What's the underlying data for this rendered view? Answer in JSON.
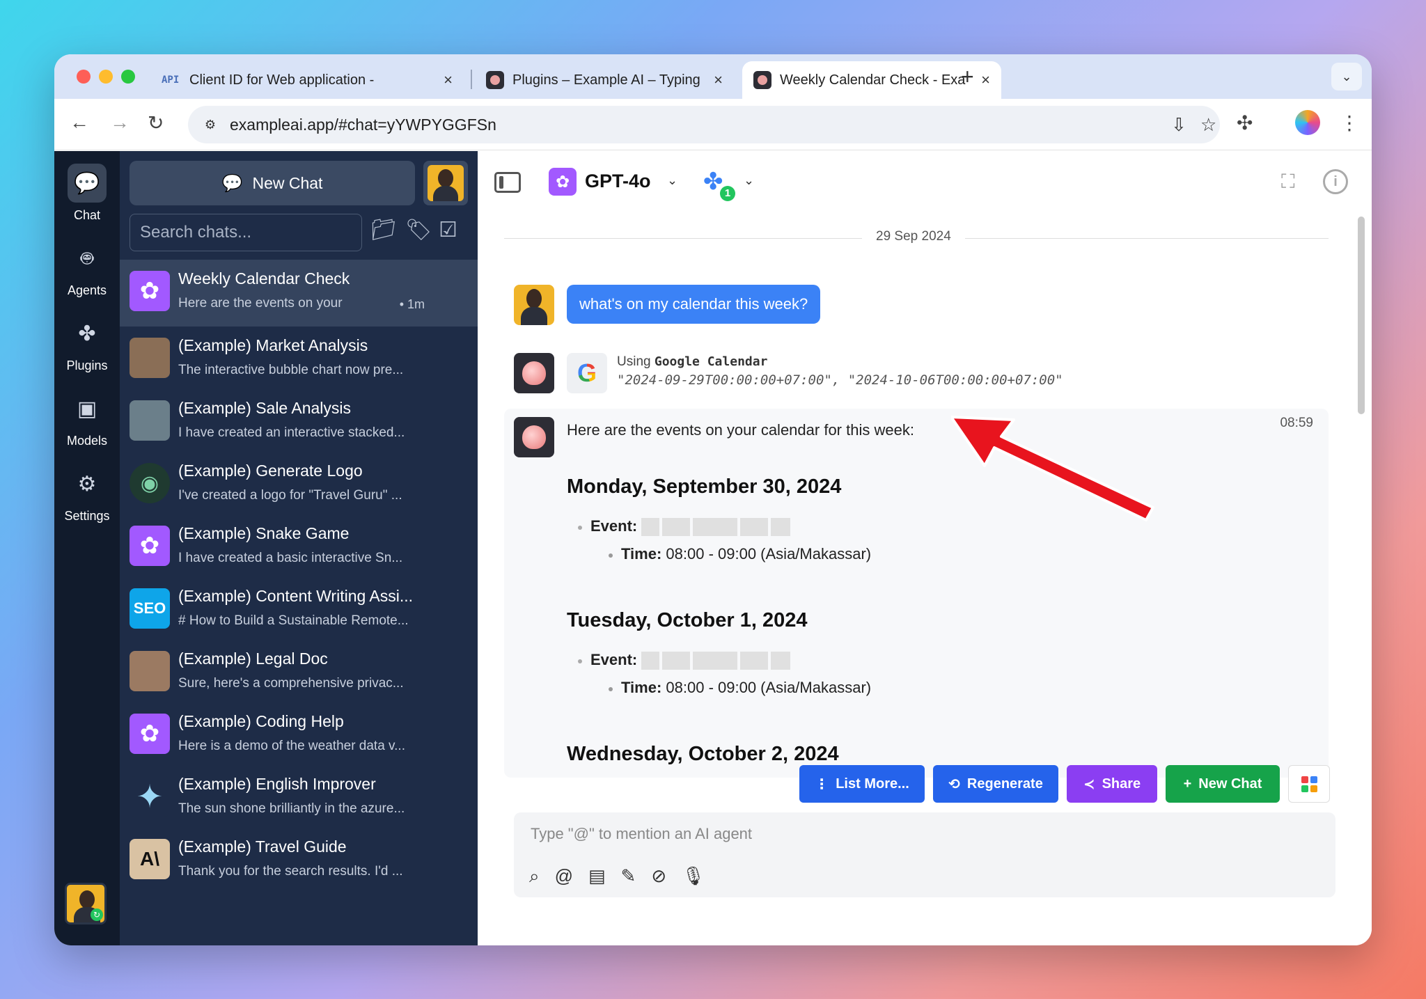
{
  "browser": {
    "tabs": [
      {
        "favicon": "API",
        "title": "Client ID for Web application - ",
        "close": "×"
      },
      {
        "title": "Plugins – Example AI – Typing",
        "close": "×"
      },
      {
        "title": "Weekly Calendar Check - Exa",
        "close": "×"
      }
    ],
    "new_tab": "+",
    "url": "exampleai.app/#chat=yYWPYGGFSn"
  },
  "rail": {
    "items": [
      {
        "label": "Chat",
        "icon": "chat-bubble-icon"
      },
      {
        "label": "Agents",
        "icon": "robot-icon"
      },
      {
        "label": "Plugins",
        "icon": "puzzle-icon"
      },
      {
        "label": "Models",
        "icon": "chip-icon"
      },
      {
        "label": "Settings",
        "icon": "gear-icon"
      }
    ]
  },
  "sidebar": {
    "new_chat": "New Chat",
    "search_placeholder": "Search chats...",
    "chats": [
      {
        "title": "Weekly Calendar Check",
        "subtitle": "Here are the events on your cal...",
        "time": "• 1m",
        "icon": "openai",
        "color": "#a259ff"
      },
      {
        "title": "(Example) Market Analysis",
        "subtitle": "The interactive bubble chart now pre...",
        "icon": "photo",
        "color": "#8a6e56"
      },
      {
        "title": "(Example) Sale Analysis",
        "subtitle": "I have created an interactive stacked...",
        "icon": "photo",
        "color": "#6b7f8a"
      },
      {
        "title": "(Example) Generate Logo",
        "subtitle": "I've created a logo for \"Travel Guru\" ...",
        "icon": "logo",
        "color": "#1f3a30"
      },
      {
        "title": "(Example) Snake Game",
        "subtitle": "I have created a basic interactive Sn...",
        "icon": "openai",
        "color": "#a259ff"
      },
      {
        "title": "(Example) Content Writing Assi...",
        "subtitle": "# How to Build a Sustainable Remote...",
        "icon": "SEO",
        "color": "#0ea5e9"
      },
      {
        "title": "(Example) Legal Doc",
        "subtitle": "Sure, here's a comprehensive privac...",
        "icon": "photo",
        "color": "#9b7a62"
      },
      {
        "title": "(Example) Coding Help",
        "subtitle": "Here is a demo of the weather data v...",
        "icon": "openai",
        "color": "#a259ff"
      },
      {
        "title": "(Example) English Improver",
        "subtitle": "The sun shone brilliantly in the azure...",
        "icon": "sparkle",
        "color": "#1e2c47"
      },
      {
        "title": "(Example) Travel Guide",
        "subtitle": "Thank you for the search results. I'd ...",
        "icon": "A\\",
        "color": "#d9c2a3"
      }
    ]
  },
  "header": {
    "model": "GPT-4o",
    "plugin_count": "1"
  },
  "conversation": {
    "date": "29 Sep 2024",
    "user_message": "what's on my calendar this week?",
    "tool": {
      "using": "Using",
      "name": "Google Calendar",
      "args": "\"2024-09-29T00:00:00+07:00\", \"2024-10-06T00:00:00+07:00\""
    },
    "response": {
      "time": "08:59",
      "intro": "Here are the events on your calendar for this week:",
      "days": [
        {
          "day": "Monday, September 30, 2024",
          "event_label": "Event:",
          "time_label": "Time:",
          "time": "08:00 - 09:00 (Asia/Makassar)"
        },
        {
          "day": "Tuesday, October 1, 2024",
          "event_label": "Event:",
          "time_label": "Time:",
          "time": "08:00 - 09:00 (Asia/Makassar)"
        },
        {
          "day": "Wednesday, October 2, 2024"
        }
      ]
    }
  },
  "actions": {
    "list_more": "List More...",
    "regenerate": "Regenerate",
    "share": "Share",
    "new_chat": "New Chat"
  },
  "composer": {
    "placeholder": "Type \"@\" to mention an AI agent"
  },
  "colors": {
    "accent_blue": "#2563eb",
    "share_purple": "#8b3ef2",
    "new_chat_green": "#16a34a",
    "sidebar_bg": "#1e2c47",
    "arrow_red": "#e8141e"
  }
}
